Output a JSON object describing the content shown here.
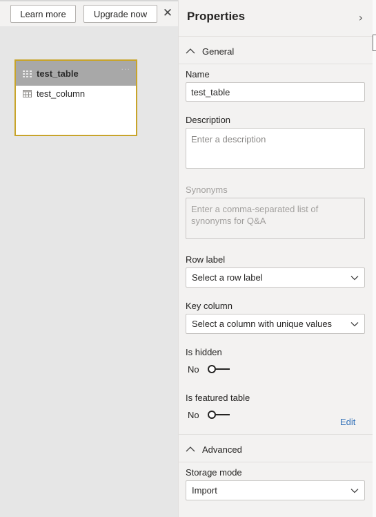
{
  "canvas": {
    "learn_more_label": "Learn more",
    "upgrade_now_label": "Upgrade now",
    "close_glyph": "✕",
    "table_card": {
      "name": "test_table",
      "more_glyph": "···",
      "columns": [
        {
          "name": "test_column"
        }
      ]
    }
  },
  "properties": {
    "title": "Properties",
    "collapse_glyph": "›",
    "general": {
      "header": "General",
      "name_label": "Name",
      "name_value": "test_table",
      "description_label": "Description",
      "description_placeholder": "Enter a description",
      "synonyms_label": "Synonyms",
      "synonyms_placeholder": "Enter a comma-separated list of synonyms for Q&A",
      "row_label_label": "Row label",
      "row_label_value": "Select a row label",
      "key_column_label": "Key column",
      "key_column_value": "Select a column with unique values",
      "is_hidden_label": "Is hidden",
      "is_hidden_value": "No",
      "is_featured_label": "Is featured table",
      "is_featured_value": "No",
      "edit_label": "Edit"
    },
    "advanced": {
      "header": "Advanced",
      "storage_mode_label": "Storage mode",
      "storage_mode_value": "Import"
    }
  },
  "colors": {
    "selection_border": "#c8a42a",
    "card_header": "#a8a8a8",
    "link": "#2f6fb7"
  }
}
